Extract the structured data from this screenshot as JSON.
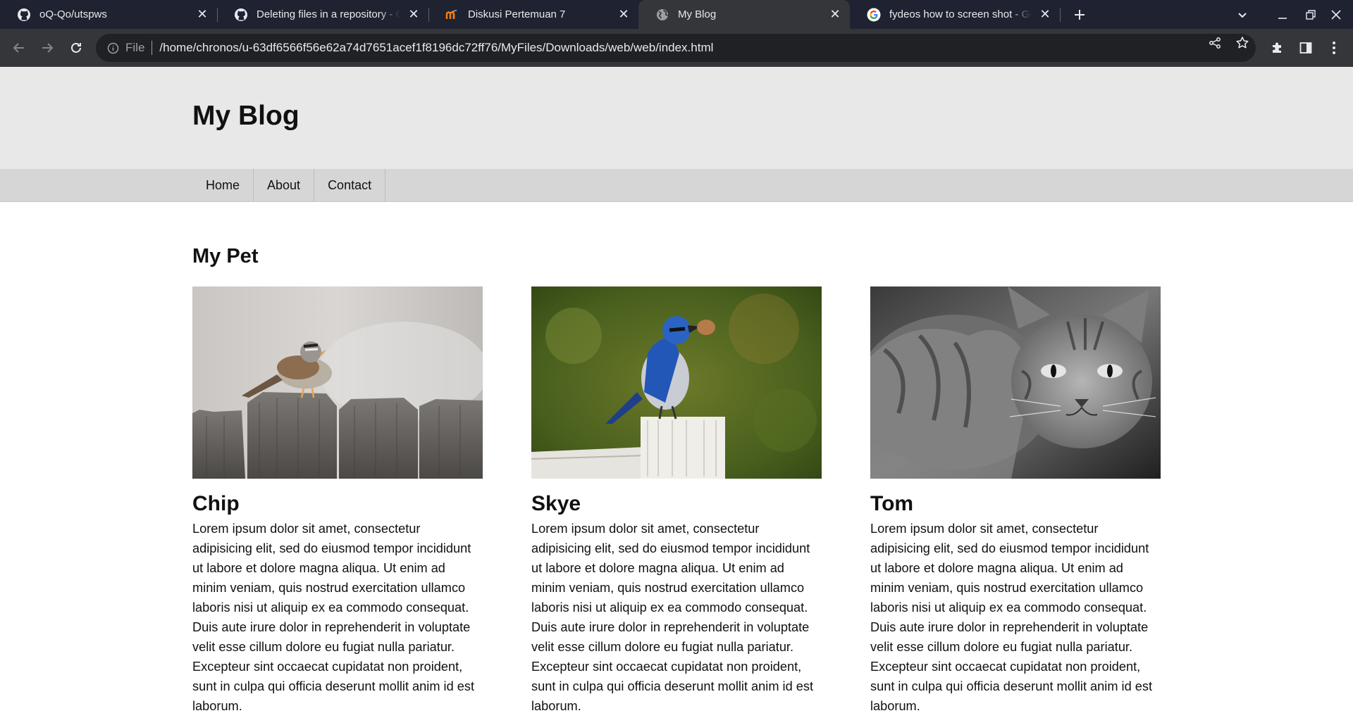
{
  "browser": {
    "tabs": [
      {
        "title": "oQ-Qo/utspws",
        "icon": "github-icon",
        "active": false
      },
      {
        "title": "Deleting files in a repository - GitHub",
        "icon": "github-icon",
        "active": false
      },
      {
        "title": "Diskusi Pertemuan 7",
        "icon": "moodle-icon",
        "active": false
      },
      {
        "title": "My Blog",
        "icon": "globe-icon",
        "active": true
      },
      {
        "title": "fydeos how to screen shot - Google Search",
        "icon": "google-icon",
        "active": false
      }
    ],
    "address": {
      "scheme": "File",
      "url": "/home/chronos/u-63df6566f56e62a74d7651acef1f8196dc72ff76/MyFiles/Downloads/web/web/index.html"
    },
    "colors": {
      "tabstrip": "#1f2230",
      "toolbar": "#35363a",
      "omnibox": "#202124"
    }
  },
  "site": {
    "title": "My Blog",
    "nav": [
      "Home",
      "About",
      "Contact"
    ],
    "section_title": "My Pet",
    "pets": [
      {
        "name": "Chip",
        "image": "sparrow on wooden fence",
        "text": "Lorem ipsum dolor sit amet, consectetur adipisicing elit, sed do eiusmod tempor incididunt ut labore et dolore magna aliqua. Ut enim ad minim veniam, quis nostrud exercitation ullamco laboris nisi ut aliquip ex ea commodo consequat. Duis aute irure dolor in reprehenderit in voluptate velit esse cillum dolore eu fugiat nulla pariatur. Excepteur sint occaecat cupidatat non proident, sunt in culpa qui officia deserunt mollit anim id est laborum."
      },
      {
        "name": "Skye",
        "image": "blue jay on white post",
        "text": "Lorem ipsum dolor sit amet, consectetur adipisicing elit, sed do eiusmod tempor incididunt ut labore et dolore magna aliqua. Ut enim ad minim veniam, quis nostrud exercitation ullamco laboris nisi ut aliquip ex ea commodo consequat. Duis aute irure dolor in reprehenderit in voluptate velit esse cillum dolore eu fugiat nulla pariatur. Excepteur sint occaecat cupidatat non proident, sunt in culpa qui officia deserunt mollit anim id est laborum."
      },
      {
        "name": "Tom",
        "image": "black and white tabby cat",
        "text": "Lorem ipsum dolor sit amet, consectetur adipisicing elit, sed do eiusmod tempor incididunt ut labore et dolore magna aliqua. Ut enim ad minim veniam, quis nostrud exercitation ullamco laboris nisi ut aliquip ex ea commodo consequat. Duis aute irure dolor in reprehenderit in voluptate velit esse cillum dolore eu fugiat nulla pariatur. Excepteur sint occaecat cupidatat non proident, sunt in culpa qui officia deserunt mollit anim id est laborum."
      }
    ]
  }
}
